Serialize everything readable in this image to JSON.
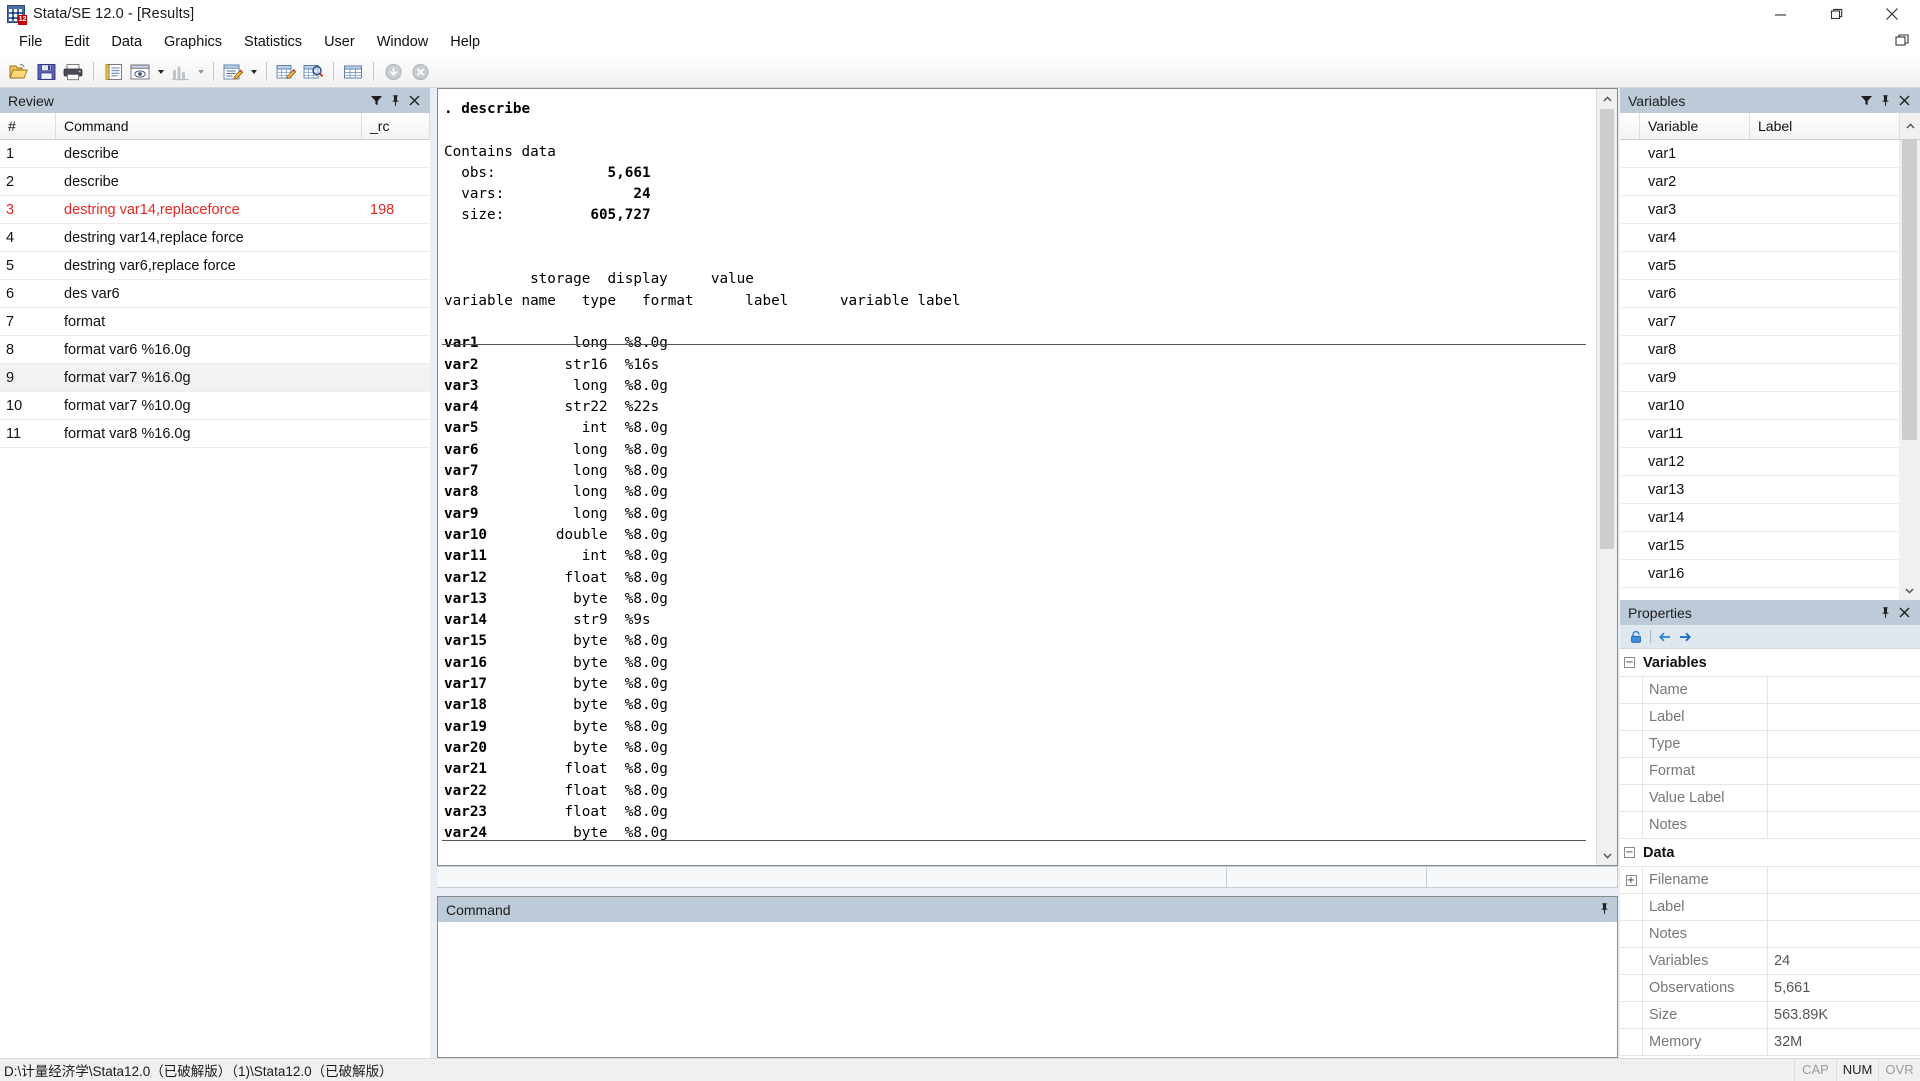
{
  "window": {
    "title": "Stata/SE 12.0 - [Results]",
    "icon": "stata-grid-icon",
    "minimize": "minimize-button",
    "maximize": "restore-button",
    "close": "close-button"
  },
  "menubar": {
    "items": [
      {
        "label": "File"
      },
      {
        "label": "Edit"
      },
      {
        "label": "Data"
      },
      {
        "label": "Graphics"
      },
      {
        "label": "Statistics"
      },
      {
        "label": "User"
      },
      {
        "label": "Window"
      },
      {
        "label": "Help"
      }
    ]
  },
  "toolbar": {
    "buttons": [
      {
        "name": "open-file-icon"
      },
      {
        "name": "save-icon"
      },
      {
        "name": "print-icon"
      },
      {
        "name": "log-begin-icon"
      },
      {
        "name": "viewer-icon",
        "dropdown": true
      },
      {
        "name": "graph-icon",
        "dropdown": true,
        "disabled": true
      },
      {
        "name": "do-file-editor-icon",
        "dropdown": true
      },
      {
        "name": "data-editor-edit-icon"
      },
      {
        "name": "data-editor-browse-icon"
      },
      {
        "name": "variables-manager-icon"
      },
      {
        "name": "continue-icon",
        "disabled": true
      },
      {
        "name": "break-icon",
        "disabled": true
      }
    ]
  },
  "review": {
    "caption": "Review",
    "caption_icons": [
      "filter-icon",
      "pin-icon",
      "close-icon"
    ],
    "columns": [
      "#",
      "Command",
      "_rc"
    ],
    "rows": [
      {
        "num": "1",
        "command": "describe",
        "rc": "",
        "error": false,
        "selected": false
      },
      {
        "num": "2",
        "command": "describe",
        "rc": "",
        "error": false,
        "selected": false
      },
      {
        "num": "3",
        "command": "destring var14,replaceforce",
        "rc": "198",
        "error": true,
        "selected": false
      },
      {
        "num": "4",
        "command": "destring var14,replace force",
        "rc": "",
        "error": false,
        "selected": false
      },
      {
        "num": "5",
        "command": "destring var6,replace force",
        "rc": "",
        "error": false,
        "selected": false
      },
      {
        "num": "6",
        "command": "des var6",
        "rc": "",
        "error": false,
        "selected": false
      },
      {
        "num": "7",
        "command": "format",
        "rc": "",
        "error": false,
        "selected": false
      },
      {
        "num": "8",
        "command": "format var6 %16.0g",
        "rc": "",
        "error": false,
        "selected": false
      },
      {
        "num": "9",
        "command": "format var7 %16.0g",
        "rc": "",
        "error": false,
        "selected": true
      },
      {
        "num": "10",
        "command": "format var7 %10.0g",
        "rc": "",
        "error": false,
        "selected": false
      },
      {
        "num": "11",
        "command": "format var8 %16.0g",
        "rc": "",
        "error": false,
        "selected": false
      }
    ]
  },
  "results": {
    "command_echo": ". describe",
    "contains": "Contains data",
    "obs_label": "obs:",
    "obs_value": "5,661",
    "vars_label": "vars:",
    "vars_value": "24",
    "size_label": "size:",
    "size_value": "605,727",
    "header_line1": "          storage  display     value",
    "header_line2": "variable name   type   format      label      variable label",
    "variables": [
      {
        "name": "var1",
        "type": "long",
        "format": "%8.0g",
        "value_label": "",
        "variable_label": ""
      },
      {
        "name": "var2",
        "type": "str16",
        "format": "%16s",
        "value_label": "",
        "variable_label": ""
      },
      {
        "name": "var3",
        "type": "long",
        "format": "%8.0g",
        "value_label": "",
        "variable_label": ""
      },
      {
        "name": "var4",
        "type": "str22",
        "format": "%22s",
        "value_label": "",
        "variable_label": ""
      },
      {
        "name": "var5",
        "type": "int",
        "format": "%8.0g",
        "value_label": "",
        "variable_label": ""
      },
      {
        "name": "var6",
        "type": "long",
        "format": "%8.0g",
        "value_label": "",
        "variable_label": ""
      },
      {
        "name": "var7",
        "type": "long",
        "format": "%8.0g",
        "value_label": "",
        "variable_label": ""
      },
      {
        "name": "var8",
        "type": "long",
        "format": "%8.0g",
        "value_label": "",
        "variable_label": ""
      },
      {
        "name": "var9",
        "type": "long",
        "format": "%8.0g",
        "value_label": "",
        "variable_label": ""
      },
      {
        "name": "var10",
        "type": "double",
        "format": "%8.0g",
        "value_label": "",
        "variable_label": ""
      },
      {
        "name": "var11",
        "type": "int",
        "format": "%8.0g",
        "value_label": "",
        "variable_label": ""
      },
      {
        "name": "var12",
        "type": "float",
        "format": "%8.0g",
        "value_label": "",
        "variable_label": ""
      },
      {
        "name": "var13",
        "type": "byte",
        "format": "%8.0g",
        "value_label": "",
        "variable_label": ""
      },
      {
        "name": "var14",
        "type": "str9",
        "format": "%9s",
        "value_label": "",
        "variable_label": ""
      },
      {
        "name": "var15",
        "type": "byte",
        "format": "%8.0g",
        "value_label": "",
        "variable_label": ""
      },
      {
        "name": "var16",
        "type": "byte",
        "format": "%8.0g",
        "value_label": "",
        "variable_label": ""
      },
      {
        "name": "var17",
        "type": "byte",
        "format": "%8.0g",
        "value_label": "",
        "variable_label": ""
      },
      {
        "name": "var18",
        "type": "byte",
        "format": "%8.0g",
        "value_label": "",
        "variable_label": ""
      },
      {
        "name": "var19",
        "type": "byte",
        "format": "%8.0g",
        "value_label": "",
        "variable_label": ""
      },
      {
        "name": "var20",
        "type": "byte",
        "format": "%8.0g",
        "value_label": "",
        "variable_label": ""
      },
      {
        "name": "var21",
        "type": "float",
        "format": "%8.0g",
        "value_label": "",
        "variable_label": ""
      },
      {
        "name": "var22",
        "type": "float",
        "format": "%8.0g",
        "value_label": "",
        "variable_label": ""
      },
      {
        "name": "var23",
        "type": "float",
        "format": "%8.0g",
        "value_label": "",
        "variable_label": ""
      },
      {
        "name": "var24",
        "type": "byte",
        "format": "%8.0g",
        "value_label": "",
        "variable_label": ""
      }
    ]
  },
  "command_window": {
    "caption": "Command",
    "pin_icon": "pin-icon",
    "value": "",
    "placeholder": ""
  },
  "variables_panel": {
    "caption": "Variables",
    "caption_icons": [
      "filter-icon",
      "pin-icon",
      "close-icon"
    ],
    "columns": [
      "Variable",
      "Label"
    ],
    "rows": [
      {
        "variable": "var1",
        "label": ""
      },
      {
        "variable": "var2",
        "label": ""
      },
      {
        "variable": "var3",
        "label": ""
      },
      {
        "variable": "var4",
        "label": ""
      },
      {
        "variable": "var5",
        "label": ""
      },
      {
        "variable": "var6",
        "label": ""
      },
      {
        "variable": "var7",
        "label": ""
      },
      {
        "variable": "var8",
        "label": ""
      },
      {
        "variable": "var9",
        "label": ""
      },
      {
        "variable": "var10",
        "label": ""
      },
      {
        "variable": "var11",
        "label": ""
      },
      {
        "variable": "var12",
        "label": ""
      },
      {
        "variable": "var13",
        "label": ""
      },
      {
        "variable": "var14",
        "label": ""
      },
      {
        "variable": "var15",
        "label": ""
      },
      {
        "variable": "var16",
        "label": ""
      }
    ]
  },
  "properties_panel": {
    "caption": "Properties",
    "caption_icons": [
      "pin-icon",
      "close-icon"
    ],
    "toolbar_icons": [
      "lock-icon",
      "back-arrow-icon",
      "forward-arrow-icon"
    ],
    "groups": [
      {
        "title": "Variables",
        "expander": "−",
        "rows": [
          {
            "name": "Name",
            "value": "",
            "gutter": ""
          },
          {
            "name": "Label",
            "value": "",
            "gutter": ""
          },
          {
            "name": "Type",
            "value": "",
            "gutter": ""
          },
          {
            "name": "Format",
            "value": "",
            "gutter": ""
          },
          {
            "name": "Value Label",
            "value": "",
            "gutter": ""
          },
          {
            "name": "Notes",
            "value": "",
            "gutter": ""
          }
        ]
      },
      {
        "title": "Data",
        "expander": "−",
        "rows": [
          {
            "name": "Filename",
            "value": "",
            "gutter": "+"
          },
          {
            "name": "Label",
            "value": "",
            "gutter": ""
          },
          {
            "name": "Notes",
            "value": "",
            "gutter": ""
          },
          {
            "name": "Variables",
            "value": "24",
            "gutter": ""
          },
          {
            "name": "Observations",
            "value": "5,661",
            "gutter": ""
          },
          {
            "name": "Size",
            "value": "563.89K",
            "gutter": ""
          },
          {
            "name": "Memory",
            "value": "32M",
            "gutter": ""
          }
        ]
      }
    ]
  },
  "statusbar": {
    "path": "D:\\计量经济学\\Stata12.0（已破解版）（1)\\Stata12.0（已破解版）",
    "caps": "CAP",
    "num": "NUM",
    "ovr": "OVR"
  },
  "colors": {
    "caption_bg": "#bdcbd8",
    "error_text": "#e8261f",
    "window_bg": "#e8eef4"
  }
}
